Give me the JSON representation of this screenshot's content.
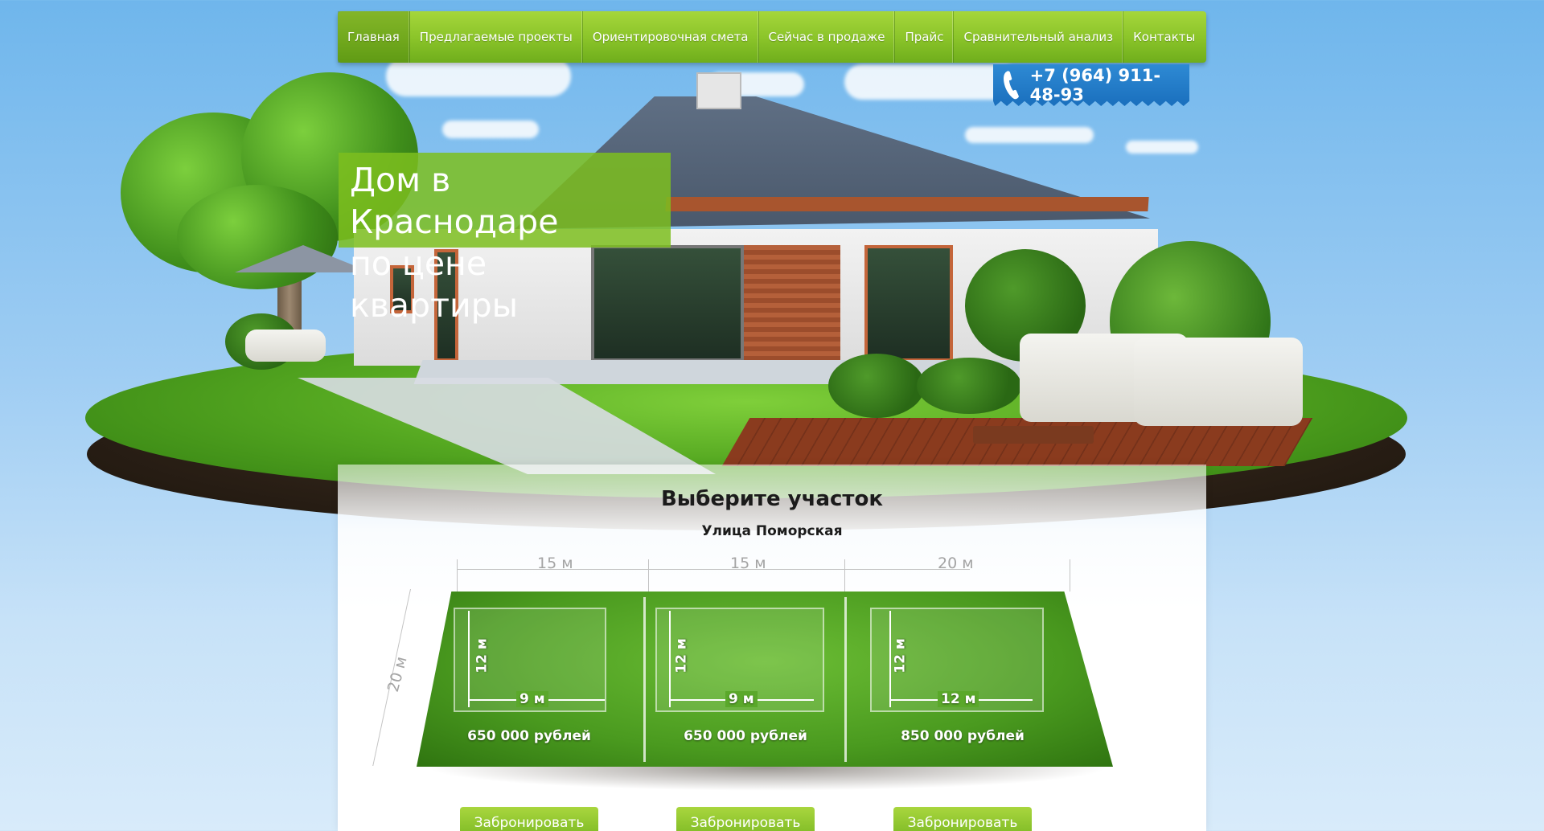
{
  "nav": {
    "items": [
      {
        "label": "Главная",
        "active": true
      },
      {
        "label": "Предлагаемые проекты",
        "active": false
      },
      {
        "label": "Ориентировочная смета",
        "active": false
      },
      {
        "label": "Сейчас в продаже",
        "active": false
      },
      {
        "label": "Прайс",
        "active": false
      },
      {
        "label": "Сравнительный анализ",
        "active": false
      },
      {
        "label": "Контакты",
        "active": false
      }
    ]
  },
  "contact": {
    "phone_icon": "phone-icon",
    "phone": "+7 (964) 911-48-93"
  },
  "hero": {
    "line1": "Дом в Краснодаре",
    "line2": "по цене квартиры"
  },
  "plots_section": {
    "title": "Выберите участок",
    "street": "Улица Поморская",
    "depth_label": "20 м",
    "plots": [
      {
        "width_label": "15 м",
        "house_depth": "12 м",
        "house_width": "9 м",
        "price": "650 000 рублей",
        "button": "Забронировать"
      },
      {
        "width_label": "15 м",
        "house_depth": "12 м",
        "house_width": "9 м",
        "price": "650 000 рублей",
        "button": "Забронировать"
      },
      {
        "width_label": "20 м",
        "house_depth": "12 м",
        "house_width": "12 м",
        "price": "850 000 рублей",
        "button": "Забронировать"
      }
    ]
  },
  "colors": {
    "nav_green": "#8cc52a",
    "phone_blue": "#1a6fbd",
    "headline_green": "#7dbe1e",
    "button_green": "#8cc52a"
  }
}
